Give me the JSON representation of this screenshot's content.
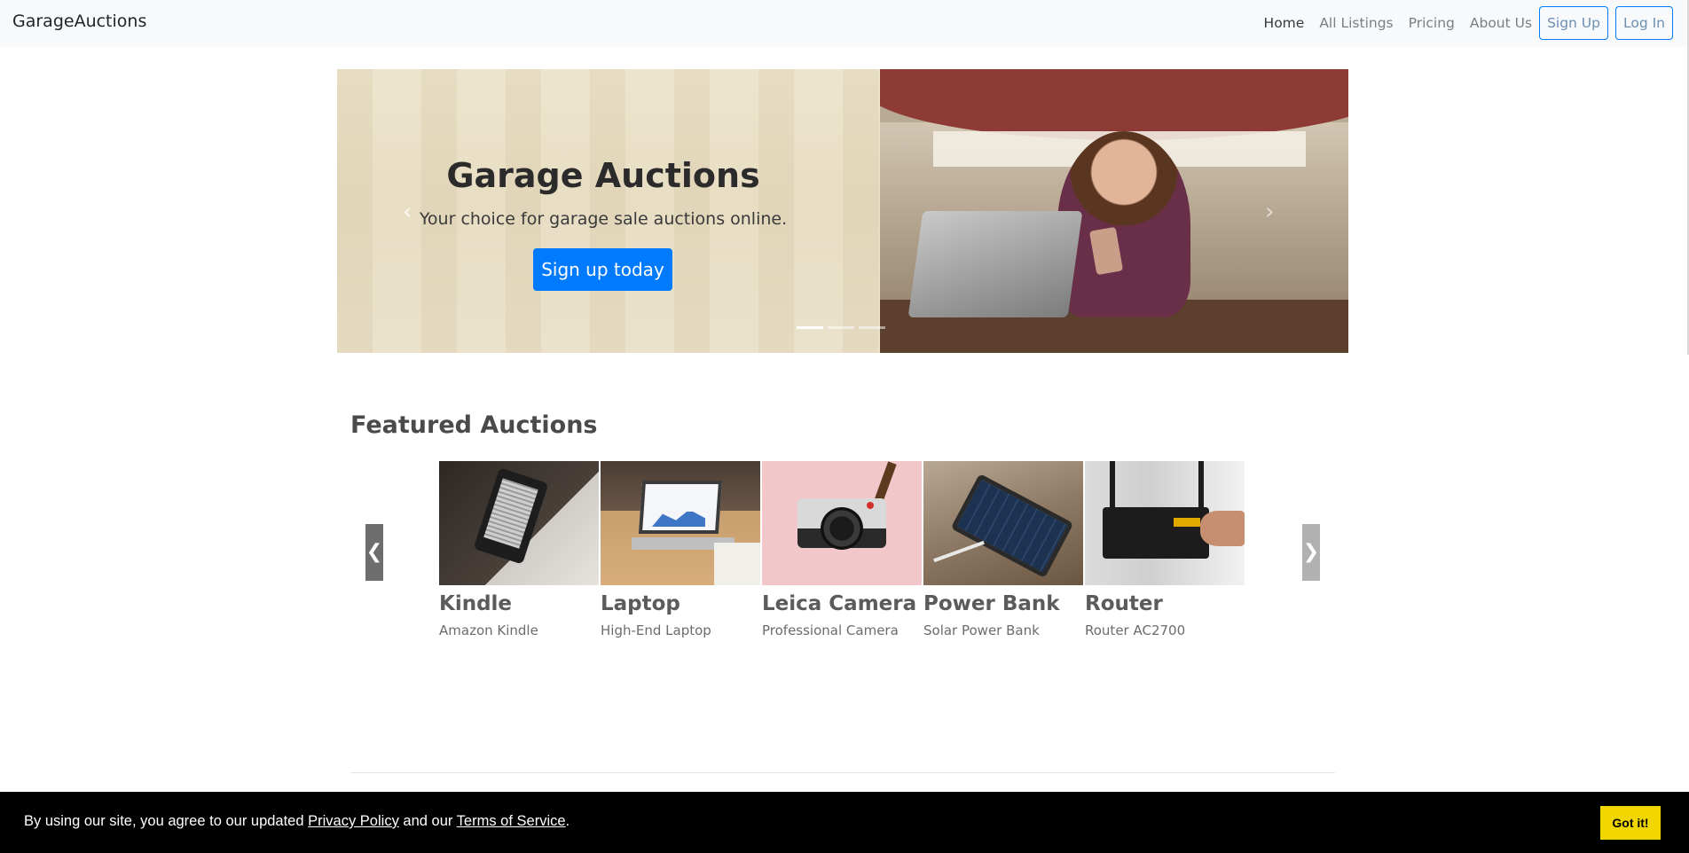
{
  "navbar": {
    "brand": "GarageAuctions",
    "links": [
      {
        "label": "Home",
        "active": true
      },
      {
        "label": "All Listings",
        "active": false
      },
      {
        "label": "Pricing",
        "active": false
      },
      {
        "label": "About Us",
        "active": false
      }
    ],
    "signup_label": "Sign Up",
    "login_label": "Log In"
  },
  "hero": {
    "title": "Garage Auctions",
    "subtitle": "Your choice for garage sale auctions online.",
    "button_label": "Sign up today",
    "prev_icon": "chevron-left-icon",
    "next_icon": "chevron-right-icon",
    "prev_glyph": "‹",
    "next_glyph": "›",
    "slide_count": 3,
    "active_slide": 1
  },
  "featured": {
    "title": "Featured Auctions",
    "prev_glyph": "❮",
    "next_glyph": "❯",
    "items": [
      {
        "name": "Kindle",
        "description": "Amazon Kindle"
      },
      {
        "name": "Laptop",
        "description": "High-End Laptop"
      },
      {
        "name": "Leica Camera",
        "description": "Professional Camera"
      },
      {
        "name": "Power Bank",
        "description": "Solar Power Bank"
      },
      {
        "name": "Router",
        "description": "Router AC2700"
      }
    ]
  },
  "cookie": {
    "text_before": "By using our site, you agree to our updated ",
    "privacy_link": "Privacy Policy",
    "text_middle": " and our ",
    "terms_link": "Terms of Service",
    "text_after": ".",
    "button_label": "Got it!"
  },
  "colors": {
    "primary": "#007bff",
    "navbar_bg": "#f8f9fa",
    "cookie_bg": "#000000",
    "cookie_button": "#f1d600"
  }
}
